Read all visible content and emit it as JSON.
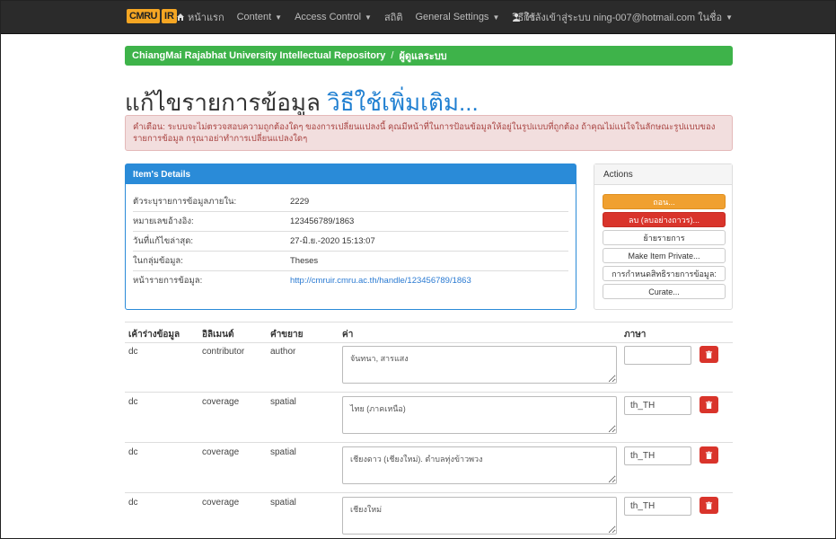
{
  "nav": {
    "brand_part1": "CMRU",
    "brand_part2": "IR",
    "home_label": "หน้าแรก",
    "content_label": "Content",
    "access_label": "Access Control",
    "stats_label": "สถิติ",
    "settings_label": "General Settings",
    "help_label": "วิธีใช้",
    "user_label": "กำลังเข้าสู่ระบบ ning-007@hotmail.com ในชื่อ"
  },
  "breadcrumb": {
    "root": "ChiangMai Rajabhat University Intellectual Repository",
    "separator": "/",
    "current": "ผู้ดูแลระบบ"
  },
  "page": {
    "title": "แก้ไขรายการข้อมูล",
    "title_link": "วิธีใช้เพิ่มเติม..."
  },
  "alert": {
    "text": "คำเตือน: ระบบจะไม่ตรวจสอบความถูกต้องใดๆ ของการเปลี่ยนแปลงนี้ คุณมีหน้าที่ในการป้อนข้อมูลให้อยู่ในรูปแบบที่ถูกต้อง ถ้าคุณไม่แน่ใจในลักษณะรูปแบบของรายการข้อมูล กรุณาอย่าทำการเปลี่ยนแปลงใดๆ"
  },
  "details": {
    "heading": "Item's Details",
    "rows": [
      {
        "label": "ตัวระบุรายการข้อมูลภายใน:",
        "value": "2229"
      },
      {
        "label": "หมายเลขอ้างอิง:",
        "value": "123456789/1863"
      },
      {
        "label": "วันที่แก้ไขล่าสุด:",
        "value": "27-มิ.ย.-2020 15:13:07"
      },
      {
        "label": "ในกลุ่มข้อมูล:",
        "value": "Theses"
      },
      {
        "label": "หน้ารายการข้อมูล:",
        "value": "http://cmruir.cmru.ac.th/handle/123456789/1863"
      }
    ]
  },
  "actions": {
    "heading": "Actions",
    "withdraw": "ถอน...",
    "delete": "ลบ (ลบอย่างถาวร)...",
    "move": "ย้ายรายการ",
    "private": "Make Item Private...",
    "authorizations": "การกำหนดสิทธิรายการข้อมูล:",
    "curate": "Curate..."
  },
  "metadata": {
    "headers": {
      "element": "เค้าร่างข้อมูล",
      "qualifier": "อิลิเมนต์",
      "description": "คำขยาย",
      "value": "ค่า",
      "language": "ภาษา"
    },
    "rows": [
      {
        "schema": "dc",
        "element": "contributor",
        "qualifier": "author",
        "value": "จันทนา, สารแสง",
        "lang": ""
      },
      {
        "schema": "dc",
        "element": "coverage",
        "qualifier": "spatial",
        "value": "ไทย (ภาคเหนือ)",
        "lang": "th_TH"
      },
      {
        "schema": "dc",
        "element": "coverage",
        "qualifier": "spatial",
        "value": "เชียงดาว (เชียงใหม่). ตำบลทุ่งข้าวพวง",
        "lang": "th_TH"
      },
      {
        "schema": "dc",
        "element": "coverage",
        "qualifier": "spatial",
        "value": "เชียงใหม่",
        "lang": "th_TH"
      }
    ]
  },
  "icons": {
    "home": "home-icon",
    "user": "user-icon",
    "trash": "trash-icon"
  },
  "colors": {
    "navbar": "#2b2b2b",
    "brand": "#f5a623",
    "breadcrumb": "#3eb34a",
    "accent": "#1f7fd1",
    "panel": "#2a8bd8",
    "alert_bg": "#f2dede",
    "alert_text": "#a94442",
    "warning": "#f0a030",
    "danger": "#d9342b"
  }
}
